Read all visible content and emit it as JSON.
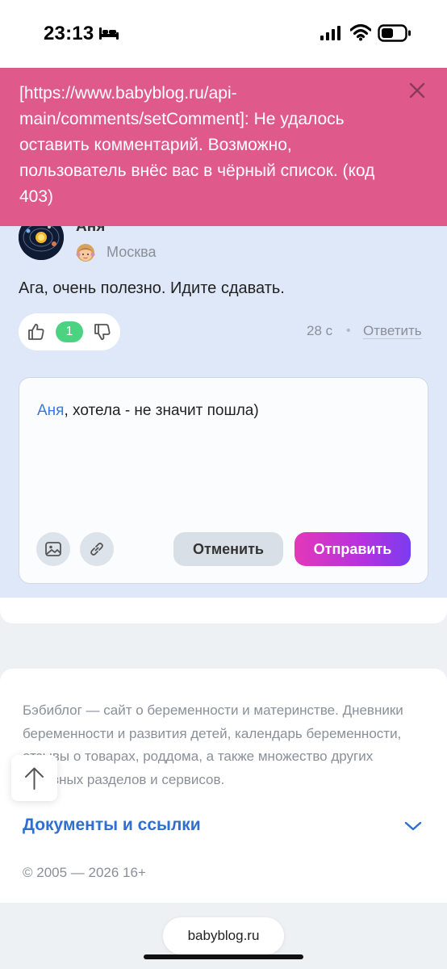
{
  "status_bar": {
    "time": "23:13",
    "focus_icon": "bed-icon",
    "signal_icon": "cellular-signal-icon",
    "wifi_icon": "wifi-icon",
    "battery_icon": "battery-icon"
  },
  "error_banner": {
    "message": "[https://www.babyblog.ru/api-main/comments/setComment]: Не удалось оставить комментарий. Возможно, пользователь внёс вас в чёрный список. (код 403)",
    "close_icon": "close-icon",
    "color": "#df5a8a"
  },
  "comment": {
    "author": "Аня",
    "city": "Москва",
    "text": "Ага, очень полезно. Идите сдавать.",
    "votes": "1",
    "time": "28 с",
    "separator": "•",
    "reply_label": "Ответить",
    "more_icon": "more-dots-icon",
    "badge_icon": "girl-emoji-icon",
    "background": "#dfe8f8"
  },
  "reply": {
    "mention": "Аня",
    "text": ", хотела - не значит пошла)",
    "cancel_label": "Отменить",
    "submit_label": "Отправить",
    "image_icon": "image-icon",
    "link_icon": "link-icon"
  },
  "footer": {
    "description": "Бэбиблог — сайт о беременности и материнстве. Дневники беременности и развития детей, календарь беременности, отзывы о товарах, роддома, а также множество других полезных разделов и сервисов.",
    "docs_label": "Документы и ссылки",
    "copyright": "© 2005 — 2026 16+"
  },
  "browser": {
    "url": "babyblog.ru"
  },
  "colors": {
    "accent_blue": "#2f6fd0",
    "vote_green": "#4cd382",
    "submit_gradient_start": "#e338b9",
    "submit_gradient_end": "#7a3cf0"
  }
}
